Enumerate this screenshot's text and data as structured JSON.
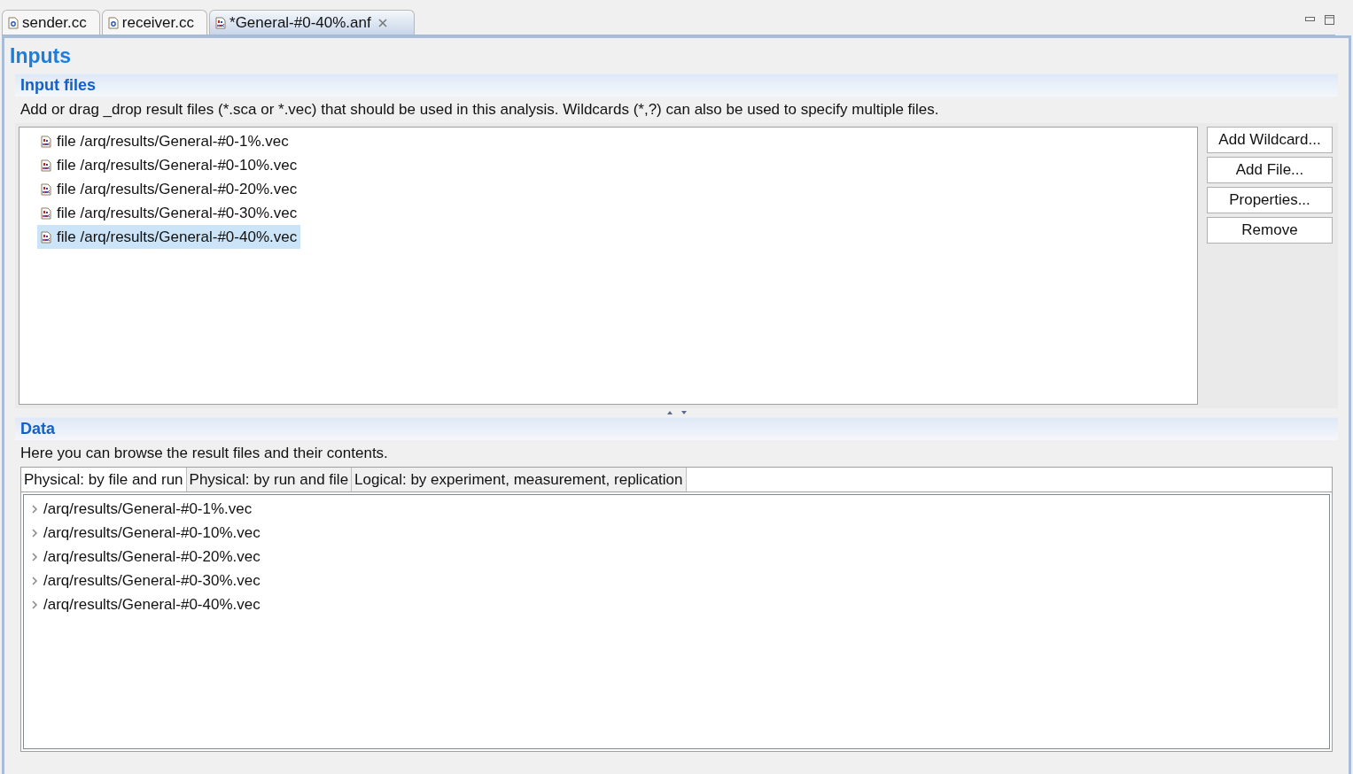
{
  "editor_tabs": [
    {
      "label": "sender.cc",
      "kind": "cc",
      "selected": false
    },
    {
      "label": "receiver.cc",
      "kind": "cc",
      "selected": false
    },
    {
      "label": "*General-#0-40%.anf",
      "kind": "anf",
      "selected": true
    }
  ],
  "page_title": "Inputs",
  "input_files": {
    "title": "Input files",
    "description": "Add or drag _drop result files (*.sca or *.vec) that should be used in this analysis. Wildcards (*,?) can also be used to specify multiple files.",
    "files": [
      {
        "label": "file /arq/results/General-#0-1%.vec",
        "selected": false
      },
      {
        "label": "file /arq/results/General-#0-10%.vec",
        "selected": false
      },
      {
        "label": "file /arq/results/General-#0-20%.vec",
        "selected": false
      },
      {
        "label": "file /arq/results/General-#0-30%.vec",
        "selected": false
      },
      {
        "label": "file /arq/results/General-#0-40%.vec",
        "selected": true
      }
    ],
    "buttons": [
      "Add Wildcard...",
      "Add File...",
      "Properties...",
      "Remove"
    ]
  },
  "data": {
    "title": "Data",
    "description": "Here you can browse the result files and their contents.",
    "tabs": [
      {
        "label": "Physical: by file and run",
        "selected": true
      },
      {
        "label": "Physical: by run and file",
        "selected": false
      },
      {
        "label": "Logical: by experiment, measurement, replication",
        "selected": false
      }
    ],
    "tree": [
      {
        "label": "/arq/results/General-#0-1%.vec",
        "expanded": false
      },
      {
        "label": "/arq/results/General-#0-10%.vec",
        "expanded": false
      },
      {
        "label": "/arq/results/General-#0-20%.vec",
        "expanded": false
      },
      {
        "label": "/arq/results/General-#0-30%.vec",
        "expanded": false
      },
      {
        "label": "/arq/results/General-#0-40%.vec",
        "expanded": false
      }
    ]
  }
}
